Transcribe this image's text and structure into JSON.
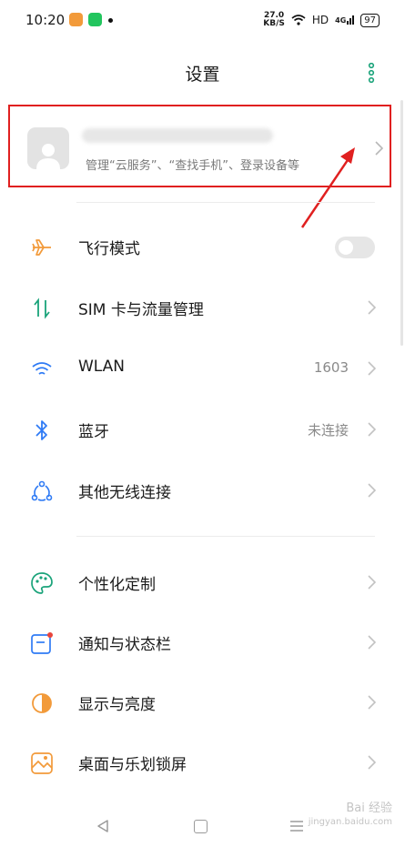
{
  "status_bar": {
    "time": "10:20",
    "net_speed": "27.0",
    "net_unit": "KB/S",
    "hd": "HD",
    "signal": "4G",
    "battery": "97"
  },
  "header": {
    "title": "设置",
    "menu_icon": "more-vertical-icon"
  },
  "account": {
    "subtitle": "管理“云服务”、“查找手机”、登录设备等",
    "avatar_icon": "person-icon"
  },
  "settings_groups": [
    {
      "items": [
        {
          "label": "飞行模式",
          "icon": "airplane-icon",
          "icon_color": "#f29a3a",
          "control": "toggle",
          "toggle_on": false
        },
        {
          "label": "SIM 卡与流量管理",
          "icon": "sim-data-icon",
          "icon_color": "#1aa37a",
          "control": "chevron"
        },
        {
          "label": "WLAN",
          "value": "1603",
          "icon": "wifi-icon",
          "icon_color": "#2f7bf5",
          "control": "chevron"
        },
        {
          "label": "蓝牙",
          "value": "未连接",
          "icon": "bluetooth-icon",
          "icon_color": "#2f7bf5",
          "control": "chevron"
        },
        {
          "label": "其他无线连接",
          "icon": "wireless-connections-icon",
          "icon_color": "#2f7bf5",
          "control": "chevron"
        }
      ]
    },
    {
      "items": [
        {
          "label": "个性化定制",
          "icon": "palette-icon",
          "icon_color": "#1aa37a",
          "control": "chevron"
        },
        {
          "label": "通知与状态栏",
          "icon": "notification-icon",
          "icon_color": "#2f7bf5",
          "control": "chevron"
        },
        {
          "label": "显示与亮度",
          "icon": "brightness-icon",
          "icon_color": "#f29a3a",
          "control": "chevron"
        },
        {
          "label": "桌面与乐划锁屏",
          "icon": "wallpaper-icon",
          "icon_color": "#f29a3a",
          "control": "chevron"
        }
      ]
    }
  ],
  "watermark": {
    "line1": "Bai 经验",
    "line2": "jingyan.baidu.com"
  },
  "annotation": {
    "color": "#e02020"
  }
}
